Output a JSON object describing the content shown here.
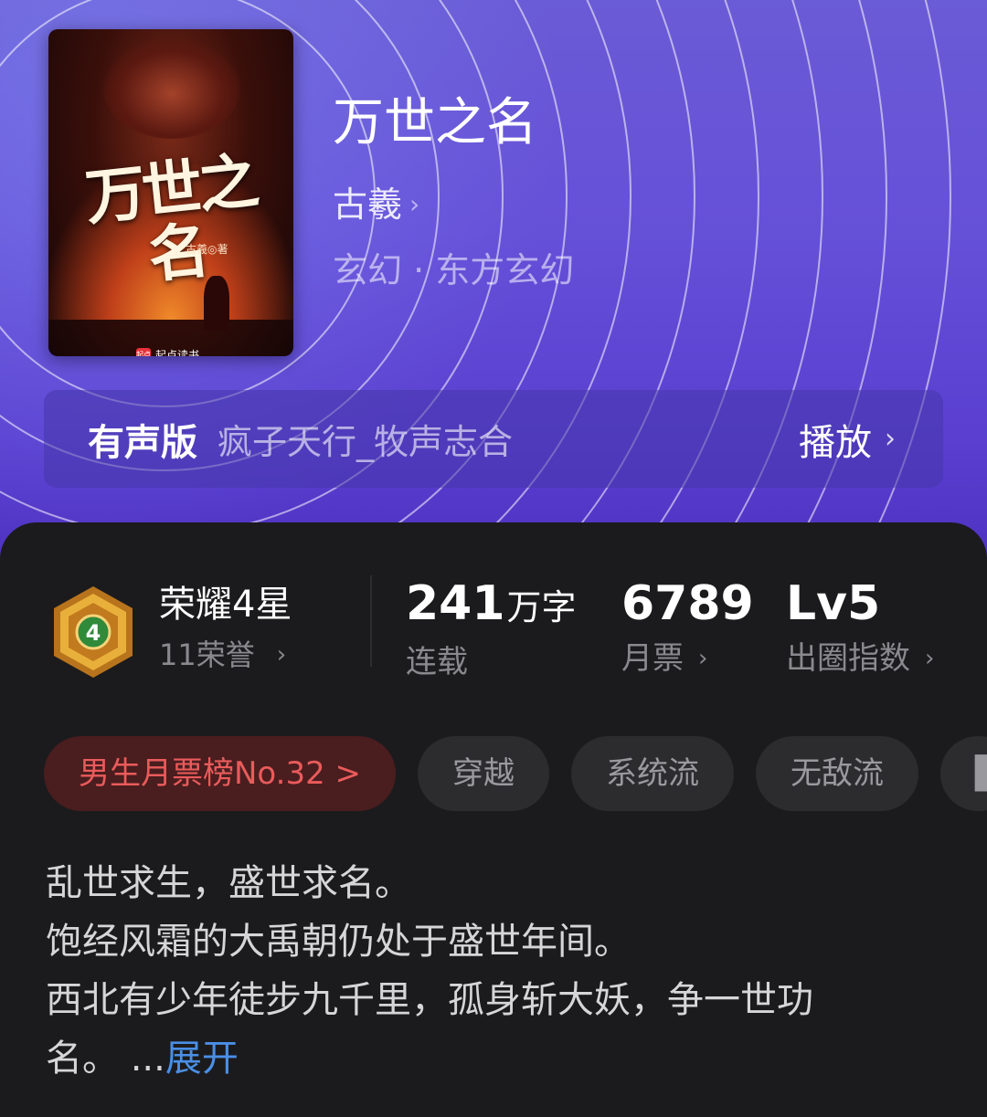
{
  "book": {
    "cover": {
      "title": "万世之名",
      "author_mark": "古羲◎著",
      "publisher": "起点读书",
      "publisher_badge": "起点"
    },
    "title": "万世之名",
    "author": "古羲",
    "genre": "玄幻 · 东方玄幻"
  },
  "audio": {
    "label": "有声版",
    "narrator": "疯子天行_牧声志合",
    "play_label": "播放"
  },
  "honor": {
    "level_number": "4",
    "title": "荣耀4星",
    "count": "11荣誉"
  },
  "stats": {
    "words": {
      "value": "241",
      "unit": "万字",
      "label": "连载"
    },
    "monthly_votes": {
      "value": "6789",
      "label": "月票"
    },
    "buzz": {
      "value": "Lv5",
      "label": "出圈指数"
    }
  },
  "tags": {
    "rank": "男生月票榜No.32 >",
    "items": [
      "穿越",
      "系统流",
      "无敌流",
      "▌"
    ]
  },
  "description": {
    "lines": [
      "乱世求生，盛世求名。",
      "饱经风霜的大禹朝仍处于盛世年间。",
      "西北有少年徒步九千里，孤身斩大妖，争一世功",
      "名。 ..."
    ],
    "expand": "展开"
  },
  "colors": {
    "hero_top": "#6a5bd6",
    "hero_bottom": "#4c2fbf",
    "panel": "#1b1b1d",
    "rank_text": "#ea5b5b",
    "link": "#4a8fe6"
  }
}
